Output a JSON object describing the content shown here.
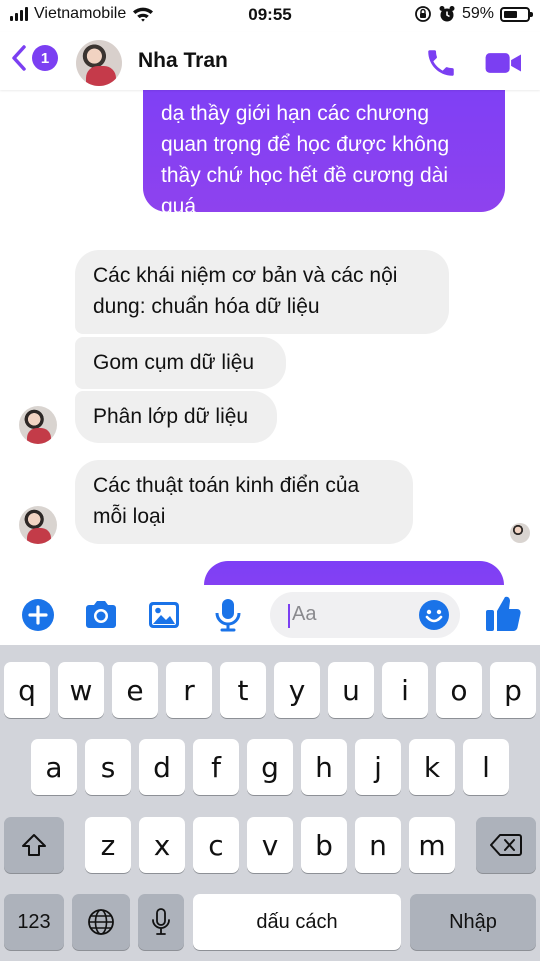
{
  "status_bar": {
    "carrier": "Vietnamobile",
    "time": "09:55",
    "battery_percent": "59%",
    "battery_level": 0.59
  },
  "header": {
    "unread_count": "1",
    "contact_name": "Nha Tran",
    "accent_color": "#7b3ff2"
  },
  "messages": [
    {
      "direction": "outgoing",
      "lines": [
        "dạ thầy giới hạn các chương",
        "quan trọng để học được không",
        "thầy chứ học hết đề cương dài",
        "quá"
      ]
    },
    {
      "direction": "incoming",
      "lines": [
        "Các khái niệm cơ bản và các nội",
        "dung: chuẩn hóa dữ liệu"
      ]
    },
    {
      "direction": "incoming",
      "lines": [
        "Gom cụm dữ liệu"
      ]
    },
    {
      "direction": "incoming",
      "lines": [
        "Phân lớp dữ liệu"
      ]
    },
    {
      "direction": "incoming",
      "lines": [
        "Các thuật toán kinh điển của",
        "mỗi loại"
      ]
    }
  ],
  "composer": {
    "placeholder": "Aa"
  },
  "keyboard": {
    "row1": [
      "q",
      "w",
      "e",
      "r",
      "t",
      "y",
      "u",
      "i",
      "o",
      "p"
    ],
    "row2": [
      "a",
      "s",
      "d",
      "f",
      "g",
      "h",
      "j",
      "k",
      "l"
    ],
    "row3": [
      "z",
      "x",
      "c",
      "v",
      "b",
      "n",
      "m"
    ],
    "numbers_key": "123",
    "space_key": "dấu cách",
    "return_key": "Nhập"
  }
}
